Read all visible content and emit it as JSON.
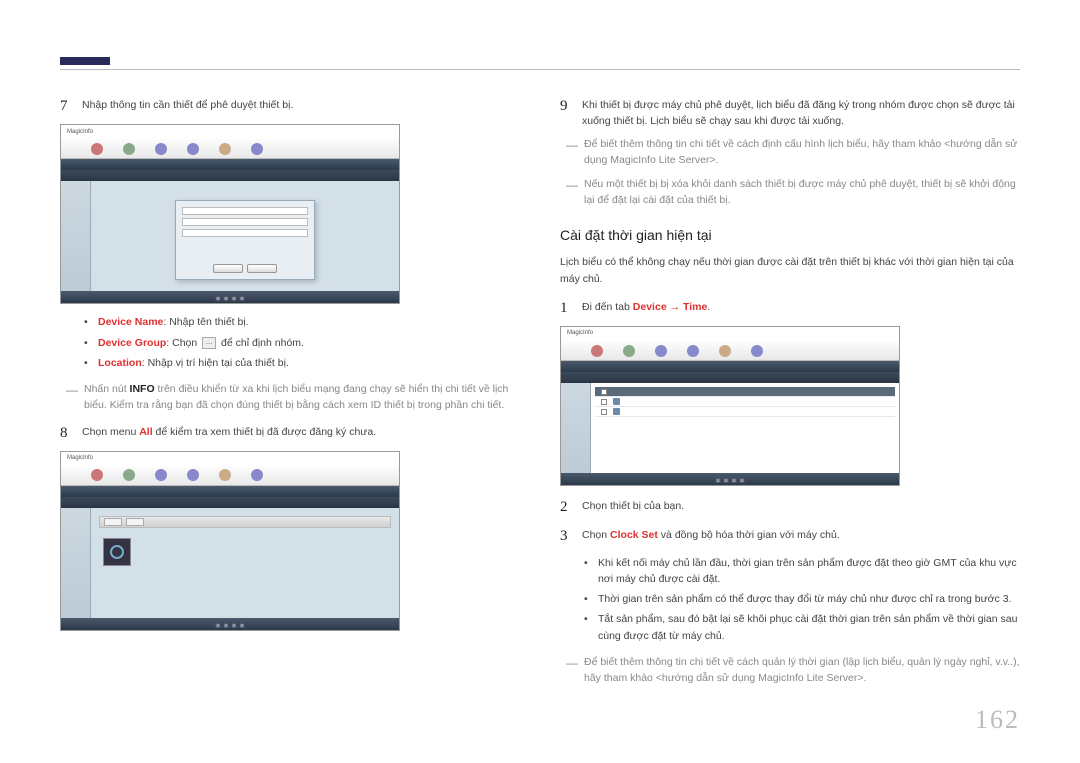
{
  "page_number": "162",
  "screenshot_brand": "MagicInfo",
  "left": {
    "step7": {
      "num": "7",
      "text": "Nhập thông tin cần thiết để phê duyệt thiết bị."
    },
    "bullets": {
      "device_name_label": "Device Name",
      "device_name_text": ": Nhập tên thiết bị.",
      "device_group_label": "Device Group",
      "device_group_pre": ": Chọn ",
      "device_group_post": " để chỉ định nhóm.",
      "group_icon_glyph": "…",
      "location_label": "Location",
      "location_text": ": Nhập vị trí hiện tại của thiết bị."
    },
    "note": {
      "pre": "Nhấn nút ",
      "info": "INFO",
      "post": " trên điều khiển từ xa khi lịch biểu mạng đang chạy sẽ hiển thị chi tiết về lịch biểu. Kiểm tra rằng bạn đã chọn đúng thiết bị bằng cách xem ID thiết bị trong phần chi tiết."
    },
    "step8": {
      "num": "8",
      "pre": "Chọn menu ",
      "all": "All",
      "post": " để kiểm tra xem thiết bị đã được đăng ký chưa."
    }
  },
  "right": {
    "step9": {
      "num": "9",
      "text": "Khi thiết bị được máy chủ phê duyệt, lịch biểu đã đăng ký trong nhóm được chọn sẽ được tải xuống thiết bị. Lịch biểu sẽ chạy sau khi được tải xuống."
    },
    "note1": "Để biết thêm thông tin chi tiết về cách định cấu hình lịch biểu, hãy tham khảo <hướng dẫn sử dụng MagicInfo Lite Server>.",
    "note2": "Nếu một thiết bị bị xóa khỏi danh sách thiết bị được máy chủ phê duyệt, thiết bị sẽ khởi động lại để đặt lại cài đặt của thiết bị.",
    "heading": "Cài đặt thời gian hiện tại",
    "intro": "Lịch biểu có thể không chạy nếu thời gian được cài đặt trên thiết bị khác với thời gian hiện tại của máy chủ.",
    "step1": {
      "num": "1",
      "pre": "Đi đến tab ",
      "devicetime": "Device → Time",
      "post": "."
    },
    "step2": {
      "num": "2",
      "text": "Chọn thiết bị của bạn."
    },
    "step3": {
      "num": "3",
      "pre": "Chọn ",
      "clockset": "Clock Set",
      "post": " và đồng bộ hóa thời gian với máy chủ."
    },
    "bullets": {
      "b1": "Khi kết nối máy chủ lần đầu, thời gian trên sản phẩm được đặt theo giờ GMT của khu vực nơi máy chủ được cài đặt.",
      "b2": "Thời gian trên sản phẩm có thể được thay đổi từ máy chủ như được chỉ ra trong bước 3.",
      "b3": "Tắt sản phẩm, sau đó bật lại sẽ khôi phục cài đặt thời gian trên sản phẩm về thời gian sau cùng được đặt từ máy chủ."
    },
    "note3": "Để biết thêm thông tin chi tiết về cách quản lý thời gian (lập lịch biểu, quản lý ngày nghỉ, v.v..), hãy tham khảo <hướng dẫn sử dụng MagicInfo Lite Server>."
  }
}
